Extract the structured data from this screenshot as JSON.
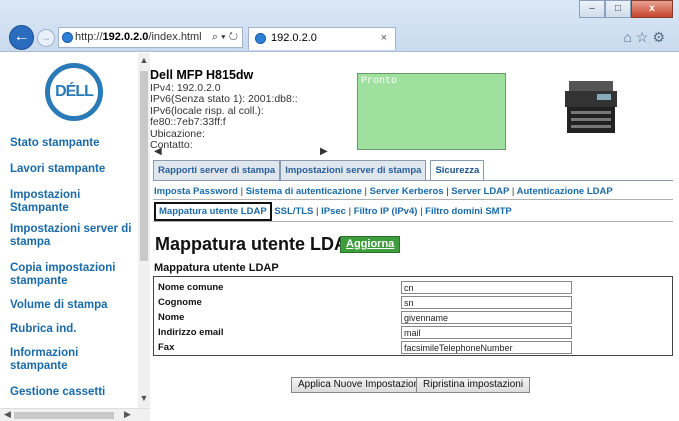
{
  "browser": {
    "address_scheme": "http://",
    "address_host": "192.0.2.0",
    "address_path": "/index.html",
    "address_tools": "⌕ ▾ ↻",
    "tab_title": "192.0.2.0",
    "tab_close": "×",
    "minimize": "–",
    "maximize": "□",
    "close": "x",
    "right_icons": "⌂☆⚙"
  },
  "sidebar": {
    "logo_text": "DÉLL",
    "items": [
      {
        "label": "Stato stampante"
      },
      {
        "label": "Lavori stampante"
      },
      {
        "label": "Impostazioni Stampante"
      },
      {
        "label": "Impostazioni server di stampa"
      },
      {
        "label": "Copia impostazioni stampante"
      },
      {
        "label": "Volume di stampa"
      },
      {
        "label": "Rubrica ind."
      },
      {
        "label": "Informazioni stampante"
      },
      {
        "label": "Gestione cassetti"
      }
    ]
  },
  "device": {
    "model": "Dell MFP H815dw",
    "ipv4": "IPv4: 192.0.2.0",
    "ipv6_stateless": "IPv6(Senza stato 1): 2001:db8::",
    "ipv6_link": "IPv6(locale risp. al coll.): fe80::7eb7:33ff:f",
    "location": "Ubicazione:",
    "contact": "Contatto:",
    "status": "Pronto"
  },
  "tabs": [
    {
      "label": "Rapporti server di stampa"
    },
    {
      "label": "Impostazioni server di stampa"
    },
    {
      "label": "Sicurezza"
    }
  ],
  "sublinks_row1": [
    "Imposta Password",
    "Sistema di autenticazione",
    "Server Kerberos",
    "Server LDAP",
    "Autenticazione LDAP"
  ],
  "sublinks_row2": [
    "Mappatura utente LDAP",
    "SSL/TLS",
    "IPsec",
    "Filtro IP (IPv4)",
    "Filtro domini SMTP"
  ],
  "separator": "|",
  "page": {
    "title": "Mappatura utente LDAP -",
    "refresh_label": "Aggiorna",
    "section_title": "Mappatura utente LDAP"
  },
  "fields": [
    {
      "label": "Nome comune",
      "value": "cn"
    },
    {
      "label": "Cognome",
      "value": "sn"
    },
    {
      "label": "Nome",
      "value": "givenname"
    },
    {
      "label": "Indirizzo email",
      "value": "mail"
    },
    {
      "label": "Fax",
      "value": "facsimileTelephoneNumber"
    }
  ],
  "buttons": {
    "apply": "Applica Nuove Impostazioni",
    "reset": "Ripristina impostazioni"
  }
}
